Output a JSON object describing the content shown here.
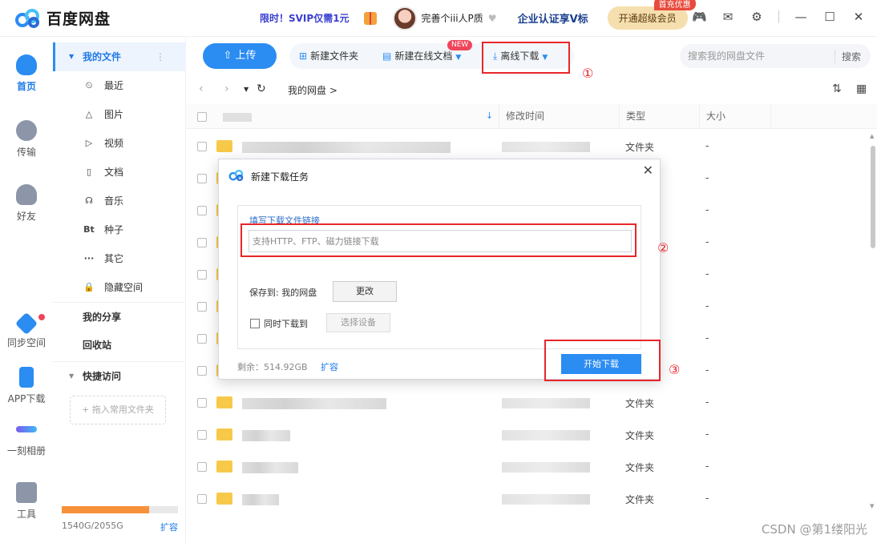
{
  "app": {
    "title": "百度网盘",
    "promo": "限时！SVIP仅需1元",
    "username": "完善个iii人P质",
    "enterprise": "企业认证享V标",
    "vip_button": "开通超级会员",
    "vip_hot": "首充优惠"
  },
  "leftnav": [
    {
      "label": "首页",
      "icon": "cloud-icon",
      "active": true
    },
    {
      "label": "传输",
      "icon": "transfer-icon"
    },
    {
      "label": "好友",
      "icon": "friends-icon"
    },
    {
      "label": "同步空间",
      "icon": "sync-icon",
      "dot": true
    },
    {
      "label": "APP下载",
      "icon": "phone-icon"
    },
    {
      "label": "一刻相册",
      "icon": "album-icon"
    },
    {
      "label": "工具",
      "icon": "tools-icon"
    }
  ],
  "sidebar": {
    "my_files": "我的文件",
    "items": [
      {
        "icon": "⏲",
        "label": "最近"
      },
      {
        "icon": "△",
        "label": "图片"
      },
      {
        "icon": "▷",
        "label": "视频"
      },
      {
        "icon": "▯",
        "label": "文档"
      },
      {
        "icon": "☊",
        "label": "音乐"
      },
      {
        "icon": "Bt",
        "label": "种子"
      },
      {
        "icon": "···",
        "label": "其它"
      },
      {
        "icon": "🔒",
        "label": "隐藏空间"
      }
    ],
    "my_share": "我的分享",
    "recycle": "回收站",
    "quick_access": "快捷访问",
    "drop_hint": "+ 拖入常用文件夹",
    "quota_text": "1540G/2055G",
    "quota_fraction": 0.749,
    "quota_expand": "扩容"
  },
  "toolbar": {
    "upload": "上传",
    "new_folder": "新建文件夹",
    "new_online_doc": "新建在线文档",
    "new_badge": "NEW",
    "offline_download": "离线下载",
    "search_placeholder": "搜索我的网盘文件",
    "search_button": "搜索"
  },
  "breadcrumb": {
    "path": "我的网盘",
    "sep": ">"
  },
  "table": {
    "headers": {
      "modified": "修改时间",
      "type": "类型",
      "size": "大小"
    },
    "rows": [
      {
        "type": "文件夹",
        "size": "-"
      },
      {
        "type": "",
        "size": "-"
      },
      {
        "type": "",
        "size": "-"
      },
      {
        "type": "",
        "size": "-"
      },
      {
        "type": "",
        "size": "-"
      },
      {
        "type": "",
        "size": "-"
      },
      {
        "type": "",
        "size": "-"
      },
      {
        "type": "",
        "size": "-"
      },
      {
        "type": "文件夹",
        "size": "-"
      },
      {
        "type": "文件夹",
        "size": "-"
      },
      {
        "type": "文件夹",
        "size": "-"
      },
      {
        "type": "文件夹",
        "size": "-"
      }
    ]
  },
  "dialog": {
    "title": "新建下载任务",
    "link_label": "填写下载文件链接",
    "link_placeholder": "支持HTTP、FTP、磁力链接下载",
    "save_to": "保存到: 我的网盘",
    "change": "更改",
    "sync_label": "同时下载到",
    "select_device": "选择设备",
    "remaining": "剩余：514.92GB",
    "expand": "扩容",
    "start": "开始下载"
  },
  "annotations": {
    "one": "①",
    "two": "②",
    "three": "③"
  },
  "watermark": "CSDN @第1缕阳光",
  "colors": {
    "accent": "#2b8cf2",
    "annotation": "#e8262a",
    "quota": "#f7913a"
  }
}
